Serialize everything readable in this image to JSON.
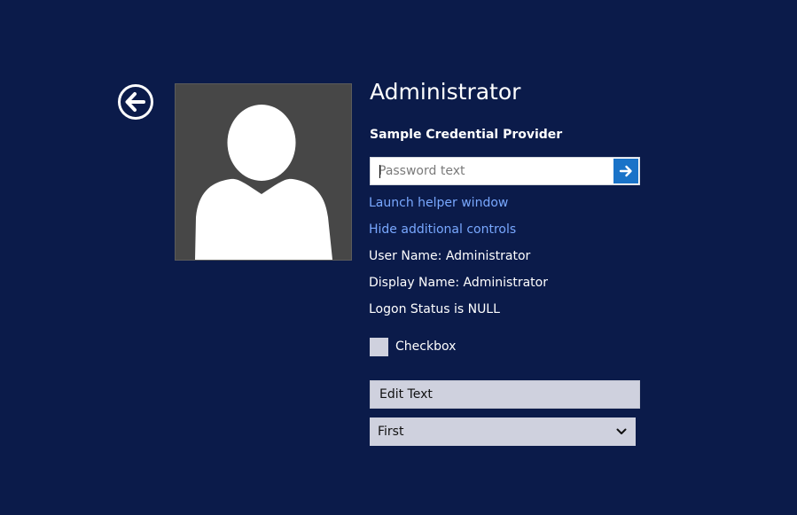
{
  "user": {
    "name": "Administrator",
    "avatar_icon": "user-silhouette-icon"
  },
  "provider": {
    "label": "Sample Credential Provider"
  },
  "password": {
    "value": "",
    "placeholder": "Password text",
    "submit_icon": "arrow-right-icon"
  },
  "back": {
    "icon": "arrow-left-circle-icon"
  },
  "links": {
    "launch_helper": "Launch helper window",
    "hide_controls": "Hide additional controls"
  },
  "info": {
    "user_name": "User Name: Administrator",
    "display_name": "Display Name: Administrator",
    "logon_status": "Logon Status is NULL"
  },
  "checkbox": {
    "label": "Checkbox",
    "checked": false
  },
  "edit_text": {
    "value": "Edit Text"
  },
  "combobox": {
    "selected": "First",
    "icon": "chevron-down-icon"
  },
  "colors": {
    "background": "#0b1b4a",
    "accent": "#1a73c8",
    "link": "#79a8ff",
    "control_fill": "#cfd1de",
    "avatar_bg": "#474747"
  }
}
